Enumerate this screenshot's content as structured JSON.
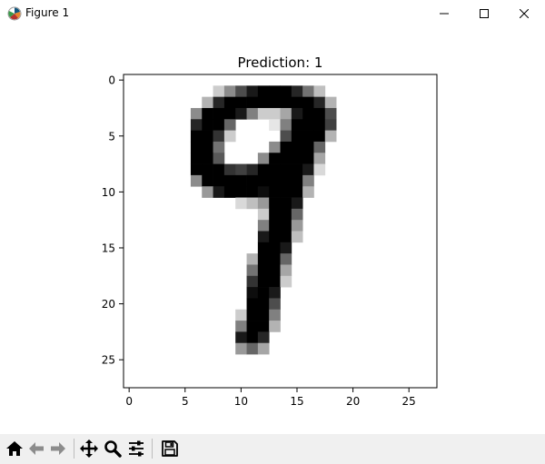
{
  "window": {
    "title": "Figure 1"
  },
  "chart_data": {
    "type": "heatmap",
    "title": "Prediction: 1",
    "colormap": "gray_r",
    "xlim": [
      -0.5,
      27.5
    ],
    "ylim": [
      27.5,
      -0.5
    ],
    "xticks": [
      0,
      5,
      10,
      15,
      20,
      25
    ],
    "yticks": [
      0,
      5,
      10,
      15,
      20,
      25
    ],
    "xtick_labels": [
      "0",
      "5",
      "10",
      "15",
      "20",
      "25"
    ],
    "ytick_labels": [
      "0",
      "5",
      "10",
      "15",
      "20",
      "25"
    ],
    "width": 28,
    "height": 28,
    "pixels": [
      {
        "row": 1,
        "values": {
          "8": 0.2,
          "9": 0.45,
          "10": 0.7,
          "11": 0.9,
          "12": 1.0,
          "13": 1.0,
          "14": 1.0,
          "15": 0.85,
          "16": 0.55,
          "17": 0.25
        }
      },
      {
        "row": 2,
        "values": {
          "7": 0.3,
          "8": 0.85,
          "9": 1.0,
          "10": 1.0,
          "11": 1.0,
          "12": 1.0,
          "13": 1.0,
          "14": 1.0,
          "15": 1.0,
          "16": 1.0,
          "17": 0.85,
          "18": 0.3
        }
      },
      {
        "row": 3,
        "values": {
          "6": 0.45,
          "7": 1.0,
          "8": 1.0,
          "9": 1.0,
          "10": 0.9,
          "11": 0.5,
          "12": 0.2,
          "13": 0.2,
          "14": 0.35,
          "15": 0.9,
          "16": 1.0,
          "17": 1.0,
          "18": 0.7
        }
      },
      {
        "row": 4,
        "values": {
          "6": 0.85,
          "7": 1.0,
          "8": 1.0,
          "9": 0.6,
          "13": 0.1,
          "14": 0.5,
          "15": 1.0,
          "16": 1.0,
          "17": 1.0,
          "18": 0.75
        }
      },
      {
        "row": 5,
        "values": {
          "6": 1.0,
          "7": 1.0,
          "8": 0.8,
          "9": 0.2,
          "14": 0.7,
          "15": 1.0,
          "16": 1.0,
          "17": 1.0,
          "18": 0.3
        }
      },
      {
        "row": 6,
        "values": {
          "6": 1.0,
          "7": 1.0,
          "8": 0.55,
          "13": 0.45,
          "14": 1.0,
          "15": 1.0,
          "16": 1.0,
          "17": 0.6
        }
      },
      {
        "row": 7,
        "values": {
          "6": 1.0,
          "7": 1.0,
          "8": 0.65,
          "12": 0.45,
          "13": 1.0,
          "14": 1.0,
          "15": 1.0,
          "16": 1.0,
          "17": 0.35
        }
      },
      {
        "row": 8,
        "values": {
          "6": 1.0,
          "7": 1.0,
          "8": 1.0,
          "9": 0.8,
          "10": 0.75,
          "11": 0.85,
          "12": 1.0,
          "13": 1.0,
          "14": 1.0,
          "15": 1.0,
          "16": 0.9,
          "17": 0.15
        }
      },
      {
        "row": 9,
        "values": {
          "6": 0.45,
          "7": 1.0,
          "8": 1.0,
          "9": 1.0,
          "10": 1.0,
          "11": 1.0,
          "12": 1.0,
          "13": 1.0,
          "14": 1.0,
          "15": 1.0,
          "16": 0.5
        }
      },
      {
        "row": 10,
        "values": {
          "7": 0.4,
          "8": 0.9,
          "9": 1.0,
          "10": 1.0,
          "11": 1.0,
          "12": 0.95,
          "13": 1.0,
          "14": 1.0,
          "15": 1.0,
          "16": 0.3
        }
      },
      {
        "row": 11,
        "values": {
          "10": 0.15,
          "11": 0.25,
          "12": 0.4,
          "13": 1.0,
          "14": 1.0,
          "15": 0.9
        }
      },
      {
        "row": 12,
        "values": {
          "12": 0.2,
          "13": 1.0,
          "14": 1.0,
          "15": 0.6
        }
      },
      {
        "row": 13,
        "values": {
          "12": 0.5,
          "13": 1.0,
          "14": 1.0,
          "15": 0.4
        }
      },
      {
        "row": 14,
        "values": {
          "12": 0.9,
          "13": 1.0,
          "14": 1.0,
          "15": 0.25
        }
      },
      {
        "row": 15,
        "values": {
          "12": 1.0,
          "13": 1.0,
          "14": 0.9
        }
      },
      {
        "row": 16,
        "values": {
          "11": 0.3,
          "12": 1.0,
          "13": 1.0,
          "14": 0.6
        }
      },
      {
        "row": 17,
        "values": {
          "11": 0.55,
          "12": 1.0,
          "13": 1.0,
          "14": 0.35
        }
      },
      {
        "row": 18,
        "values": {
          "11": 0.8,
          "12": 1.0,
          "13": 1.0,
          "14": 0.2
        }
      },
      {
        "row": 19,
        "values": {
          "11": 0.95,
          "12": 1.0,
          "13": 0.9
        }
      },
      {
        "row": 20,
        "values": {
          "11": 1.0,
          "12": 1.0,
          "13": 0.7
        }
      },
      {
        "row": 21,
        "values": {
          "10": 0.2,
          "11": 1.0,
          "12": 1.0,
          "13": 0.5
        }
      },
      {
        "row": 22,
        "values": {
          "10": 0.5,
          "11": 1.0,
          "12": 1.0,
          "13": 0.3
        }
      },
      {
        "row": 23,
        "values": {
          "10": 0.9,
          "11": 1.0,
          "12": 0.85
        }
      },
      {
        "row": 24,
        "values": {
          "10": 0.4,
          "11": 0.6,
          "12": 0.35
        }
      }
    ]
  },
  "toolbar": {
    "buttons": [
      {
        "name": "home-icon",
        "tooltip": "Home"
      },
      {
        "name": "back-icon",
        "tooltip": "Back"
      },
      {
        "name": "forward-icon",
        "tooltip": "Forward"
      },
      {
        "name": "pan-icon",
        "tooltip": "Pan"
      },
      {
        "name": "zoom-icon",
        "tooltip": "Zoom"
      },
      {
        "name": "configure-subplots-icon",
        "tooltip": "Configure subplots"
      },
      {
        "name": "save-icon",
        "tooltip": "Save"
      }
    ]
  },
  "colors": {
    "toolbar_bg": "#f0f0f0",
    "icon_dark": "#000000",
    "icon_disabled": "#8c8c8c"
  }
}
